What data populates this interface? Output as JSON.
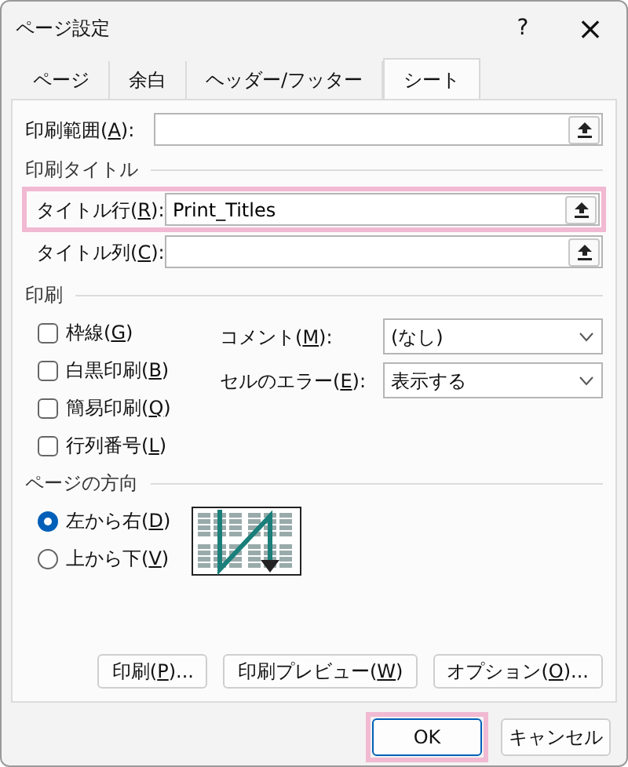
{
  "window": {
    "title": "ページ設定",
    "help": "?",
    "close": "×"
  },
  "tabs": [
    {
      "label": "ページ",
      "selected": false
    },
    {
      "label": "余白",
      "selected": false
    },
    {
      "label": "ヘッダー/フッター",
      "selected": false
    },
    {
      "label": "シート",
      "selected": true
    }
  ],
  "print_area": {
    "label": [
      "印刷範囲(",
      "A",
      "):"
    ]
  },
  "print_titles": {
    "heading": "印刷タイトル",
    "rows": [
      {
        "label": [
          "タイトル行(",
          "R",
          "):"
        ],
        "value": "Print_Titles",
        "highlighted": true
      },
      {
        "label": [
          "タイトル列(",
          "C",
          "):"
        ],
        "highlighted": false
      }
    ]
  },
  "print": {
    "heading": "印刷",
    "checkboxes": [
      {
        "label": [
          "枠線(",
          "G",
          ")"
        ],
        "checked": false
      },
      {
        "label": [
          "白黒印刷(",
          "B",
          ")"
        ],
        "checked": false
      },
      {
        "label": [
          "簡易印刷(",
          "Q",
          ")"
        ],
        "checked": false
      },
      {
        "label": [
          "行列番号(",
          "L",
          ")"
        ],
        "checked": false
      }
    ],
    "dropdowns": [
      {
        "label": [
          "コメント(",
          "M",
          "):"
        ],
        "value": "(なし)"
      },
      {
        "label": [
          "セルのエラー(",
          "E",
          "):"
        ],
        "value": "表示する"
      }
    ]
  },
  "page_order": {
    "heading": "ページの方向",
    "options": [
      {
        "label": [
          "左から右(",
          "D",
          ")"
        ],
        "selected": true
      },
      {
        "label": [
          "上から下(",
          "V",
          ")"
        ],
        "selected": false
      }
    ]
  },
  "panel_buttons": [
    {
      "label": [
        "印刷(",
        "P",
        ")..."
      ]
    },
    {
      "label": [
        "印刷プレビュー(",
        "W",
        ")"
      ]
    },
    {
      "label": [
        "オプション(",
        "O",
        ")..."
      ]
    }
  ],
  "footer_buttons": [
    {
      "label": "OK",
      "highlighted": true
    },
    {
      "label": "キャンセル",
      "highlighted": false
    }
  ]
}
